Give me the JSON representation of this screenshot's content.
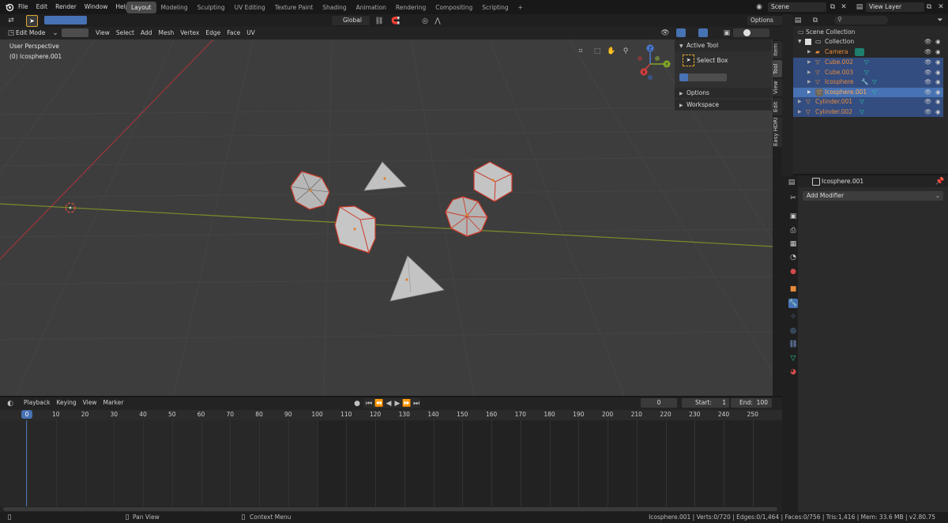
{
  "topbar": {
    "menus": [
      "File",
      "Edit",
      "Render",
      "Window",
      "Help"
    ],
    "workspaces": [
      "Layout",
      "Modeling",
      "Sculpting",
      "UV Editing",
      "Texture Paint",
      "Shading",
      "Animation",
      "Rendering",
      "Compositing",
      "Scripting"
    ],
    "active_workspace": "Layout",
    "add_tab": "+",
    "scene": "Scene",
    "view_layer": "View Layer"
  },
  "viewport_header": {
    "mode": "Edit Mode",
    "menus": [
      "View",
      "Select",
      "Add",
      "Mesh",
      "Vertex",
      "Edge",
      "Face",
      "UV"
    ],
    "orientation": "Global",
    "options": "Options"
  },
  "viewport": {
    "perspective": "User Perspective",
    "object": "(0) Icosphere.001",
    "gizmo": {
      "x": "X",
      "y": "Y",
      "z": "Z"
    }
  },
  "tool_panel": {
    "active_tool_label": "Active Tool",
    "select_box": "Select Box",
    "options": "Options",
    "workspace": "Workspace",
    "tabs": [
      "Item",
      "Tool",
      "View",
      "Edit",
      "Easy HDRI"
    ]
  },
  "outliner": {
    "root": "Scene Collection",
    "collection": "Collection",
    "items": [
      {
        "name": "Camera",
        "selected": false
      },
      {
        "name": "Cube.002",
        "selected": true
      },
      {
        "name": "Cube.003",
        "selected": true
      },
      {
        "name": "Icosphere",
        "selected": true
      },
      {
        "name": "Icosphere.001",
        "selected": true
      },
      {
        "name": "Cylinder.001",
        "selected": true
      },
      {
        "name": "Cylinder.002",
        "selected": true
      }
    ]
  },
  "properties": {
    "object": "Icosphere.001",
    "add_modifier": "Add Modifier"
  },
  "timeline": {
    "menus": [
      "Playback",
      "Keying",
      "View",
      "Marker"
    ],
    "current_frame": "0",
    "start_label": "Start:",
    "start": "1",
    "end_label": "End:",
    "end": "100",
    "ticks": [
      "0",
      "10",
      "20",
      "30",
      "40",
      "50",
      "60",
      "70",
      "80",
      "90",
      "100",
      "110",
      "120",
      "130",
      "140",
      "150",
      "160",
      "170",
      "180",
      "190",
      "200",
      "210",
      "220",
      "230",
      "240",
      "250"
    ]
  },
  "statusbar": {
    "pan_view": "Pan View",
    "context_menu": "Context Menu",
    "stats": "Icosphere.001 | Verts:0/720 | Edges:0/1,464 | Faces:0/756 | Tris:1,416 | Mem: 33.6 MB | v2.80.75"
  },
  "colors": {
    "accent": "#4772b3",
    "selection": "#334d80",
    "object_orange": "#e88a3c",
    "edge_red": "#e03c28"
  }
}
